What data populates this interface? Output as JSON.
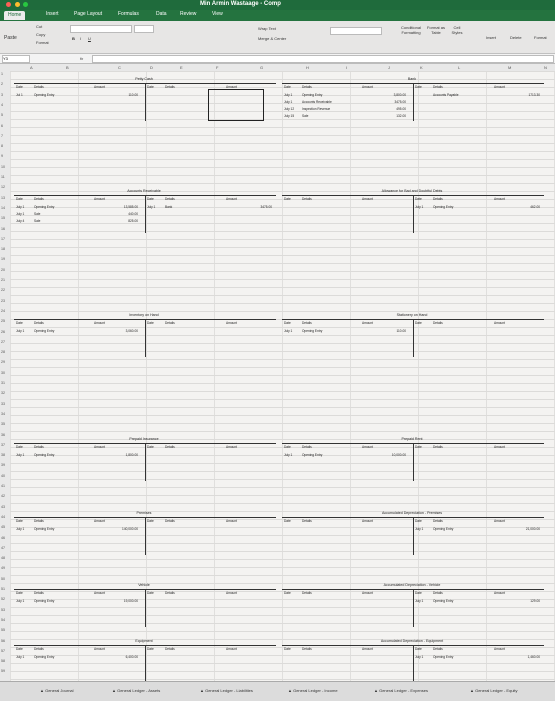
{
  "window": {
    "title": "Min Armin Wastaage - Comp"
  },
  "tabs": [
    "Home",
    "Insert",
    "Page Layout",
    "Formulas",
    "Data",
    "Review",
    "View"
  ],
  "ribbon": {
    "cut": "Cut",
    "copy": "Copy",
    "format": "Format",
    "paste": "Paste",
    "wrap_text": "Wrap Text",
    "merge_center": "Merge & Center",
    "conditional_formatting": "Conditional Formatting",
    "format_as_table": "Format as Table",
    "cell_styles": "Cell Styles",
    "insert": "Insert",
    "delete": "Delete",
    "format_cells": "Format"
  },
  "formula_bar": {
    "name_box": "Y3",
    "fx": "fx"
  },
  "columns": [
    "A",
    "B",
    "C",
    "D",
    "E",
    "F",
    "G",
    "H",
    "I",
    "J",
    "K",
    "L",
    "M",
    "N"
  ],
  "rows": [
    "1",
    "2",
    "3",
    "4",
    "5",
    "6",
    "7",
    "8",
    "9",
    "10",
    "11",
    "12",
    "13",
    "14",
    "15",
    "16",
    "17",
    "18",
    "19",
    "20",
    "21",
    "22",
    "23",
    "24",
    "25",
    "26",
    "27",
    "28",
    "29",
    "30",
    "31",
    "32",
    "33",
    "34",
    "35",
    "36",
    "37",
    "38",
    "39",
    "40",
    "41",
    "42",
    "43",
    "44",
    "45",
    "46",
    "47",
    "48",
    "49",
    "50",
    "51",
    "52",
    "53",
    "54",
    "55",
    "56",
    "57",
    "58",
    "59"
  ],
  "accounts": [
    {
      "title": "Petty Cash",
      "hdr": [
        "Date",
        "Details",
        "Amount",
        "Date",
        "Details",
        "Amount"
      ],
      "left": [
        [
          "Jul 1",
          "Opening Entry",
          "110.00"
        ]
      ],
      "right": []
    },
    {
      "title": "Bank",
      "hdr": [
        "Date",
        "Details",
        "Amount",
        "Date",
        "Details",
        "Amount"
      ],
      "left": [
        [
          "July 1",
          "Opening Entry",
          ""
        ],
        [
          "July 1",
          "Accounts Receivable",
          "3475.00"
        ],
        [
          "July 12",
          "Inspection Revenue",
          "495.00"
        ],
        [
          "July 15",
          "Sale",
          "132.00"
        ]
      ],
      "right": [
        [
          "",
          "Accounts Payable",
          "1713.30"
        ]
      ],
      "left_top_num": "3,800.00"
    },
    {
      "title": "Accounts Receivable",
      "hdr": [
        "Date",
        "Details",
        "Amount",
        "Date",
        "Details",
        "Amount"
      ],
      "left": [
        [
          "July 1",
          "Opening Entry",
          "13,585.00"
        ],
        [
          "July 1",
          "Sale",
          "440.00"
        ],
        [
          "July 4",
          "Sale",
          "825.00"
        ]
      ],
      "right": [
        [
          "July 1",
          "Bank",
          "3475.00"
        ]
      ]
    },
    {
      "title": "Allowance for Bad and Doubtful Debts",
      "hdr": [
        "Date",
        "Details",
        "Amount",
        "Date",
        "Details",
        "Amount"
      ],
      "left": [],
      "right": [
        [
          "July 1",
          "Opening Entry",
          "462.00"
        ]
      ]
    },
    {
      "title": "Inventory on Hand",
      "hdr": [
        "Date",
        "Details",
        "Amount",
        "Date",
        "Details",
        "Amount"
      ],
      "left": [
        [
          "July 1",
          "Opening Entry",
          "3,060.00"
        ]
      ],
      "right": []
    },
    {
      "title": "Stationery on Hand",
      "hdr": [
        "Date",
        "Details",
        "Amount",
        "Date",
        "Details",
        "Amount"
      ],
      "left": [
        [
          "July 1",
          "Opening Entry",
          "110.00"
        ]
      ],
      "right": []
    },
    {
      "title": "Prepaid Insurance",
      "hdr": [
        "Date",
        "Details",
        "Amount",
        "Date",
        "Details",
        "Amount"
      ],
      "left": [
        [
          "July 1",
          "Opening Entry",
          "1,800.00"
        ]
      ],
      "right": []
    },
    {
      "title": "Prepaid Rent",
      "hdr": [
        "Date",
        "Details",
        "Amount",
        "Date",
        "Details",
        "Amount"
      ],
      "left": [
        [
          "July 1",
          "Opening Entry",
          "10,000.00"
        ]
      ],
      "right": []
    },
    {
      "title": "Premises",
      "hdr": [
        "Date",
        "Details",
        "Amount",
        "Date",
        "Details",
        "Amount"
      ],
      "left": [
        [
          "July 1",
          "Opening Entry",
          "140,000.00"
        ]
      ],
      "right": []
    },
    {
      "title": "Accumulated Depreciation - Premises",
      "hdr": [
        "Date",
        "Details",
        "Amount",
        "Date",
        "Details",
        "Amount"
      ],
      "left": [],
      "right": [
        [
          "July 1",
          "Opening Entry",
          "21,000.00"
        ]
      ]
    },
    {
      "title": "Vehicle",
      "hdr": [
        "Date",
        "Details",
        "Amount",
        "Date",
        "Details",
        "Amount"
      ],
      "left": [
        [
          "July 1",
          "Opening Entry",
          "19,000.00"
        ]
      ],
      "right": []
    },
    {
      "title": "Accumulated Depreciation - Vehicle",
      "hdr": [
        "Date",
        "Details",
        "Amount",
        "Date",
        "Details",
        "Amount"
      ],
      "left": [],
      "right": [
        [
          "July 1",
          "Opening Entry",
          "129.00"
        ]
      ]
    },
    {
      "title": "Equipment",
      "hdr": [
        "Date",
        "Details",
        "Amount",
        "Date",
        "Details",
        "Amount"
      ],
      "left": [
        [
          "July 1",
          "Opening Entry",
          "6,400.00"
        ]
      ],
      "right": []
    },
    {
      "title": "Accumulated Depreciation - Equipment",
      "hdr": [
        "Date",
        "Details",
        "Amount",
        "Date",
        "Details",
        "Amount"
      ],
      "left": [],
      "right": [
        [
          "July 1",
          "Opening Entry",
          "1,460.00"
        ]
      ]
    }
  ],
  "sheets": [
    "General Journal",
    "General Ledger - Assets",
    "General Ledger - Liabilities",
    "General Ledger - Income",
    "General Ledger - Expenses",
    "General Ledger - Equity"
  ],
  "colors": {
    "title_bar": "#1f6b3c",
    "tab_bar": "#24733f",
    "grid_bg": "#f4f3f1"
  }
}
